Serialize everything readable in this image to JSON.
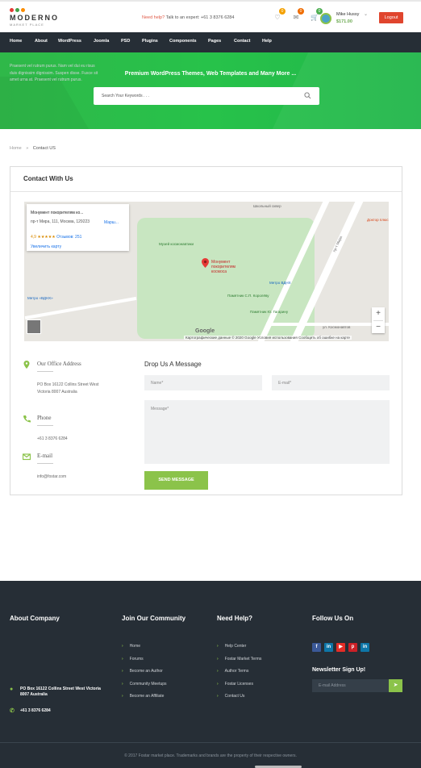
{
  "header": {
    "logo": {
      "brand": "MODERNO",
      "sub": "MARKET PLACE",
      "dot_colors": [
        "#e53935",
        "#43a047",
        "#fb8c00"
      ]
    },
    "help_prefix": "Need help?",
    "help_text": " Talk to an expert: +61 3 8376 6284",
    "icons": [
      {
        "icon": "heart-icon",
        "badge": "0",
        "badge_color": "#f4a100"
      },
      {
        "icon": "mail-icon",
        "badge": "0",
        "badge_color": "#ef6c00"
      },
      {
        "icon": "cart-icon",
        "badge": "0",
        "badge_color": "#4caf50"
      }
    ],
    "user_name": "Mike Hussy",
    "user_balance": "$171.00",
    "logout_label": "Logout"
  },
  "nav": {
    "items": [
      "Home",
      "About",
      "WordPress",
      "Joomla",
      "PSD",
      "Plugins",
      "Components",
      "Pages",
      "Contact",
      "Help"
    ]
  },
  "hero": {
    "title": "Premium WordPress Themes, Web Templates and Many More ...",
    "search_placeholder": "Search Your Keywords . . ."
  },
  "breadcrumb": {
    "home": "Home",
    "sep": "»",
    "current": "Contact US"
  },
  "card": {
    "title": "Contact With Us",
    "map": {
      "place_name": "Монумент покорителям ко...",
      "place_address": "пр-т Мира, 111, Москва, 129223",
      "rating": "4,9 ★★★★★",
      "reviews": "Отзывов: 251",
      "enlarge": "Увеличить карту",
      "route": "Марш...",
      "pin_label": "Монумент покорителям космоса",
      "google": "Google",
      "attribution": "Картографические данные © 2020 Google   Условия использования   Сообщить об ошибке на карте",
      "labels": {
        "museum": "Музей космонавтики",
        "metro_vdnh": "Метро ВДНХ",
        "metro_vdnh_short": "Метро «ВДНХ»",
        "school": "Школьный сквер",
        "korolev": "Памятник С.П. Королёву",
        "gagarin": "Памятник Ю. Гагарину",
        "kosmonavtov": "ул. Космонавтов",
        "doctor": "Доктор плюс",
        "mira": "пр-т Мира"
      }
    },
    "office": {
      "label": "Our Office Address",
      "value": "PO Box 16122 Collins Street West Victoria 8007 Australia"
    },
    "phone": {
      "label": "Phone",
      "value": "+61 3 8376 6284"
    },
    "email": {
      "label": "E-mail",
      "value": "info@fostar.com"
    },
    "form": {
      "title": "Drop Us A Message",
      "name_placeholder": "Name*",
      "email_placeholder": "E-mail*",
      "message_placeholder": "Message*",
      "send_label": "SEND MESSAGE"
    }
  },
  "footer": {
    "about": {
      "title": "About Company",
      "text": "Praesent vel rutrum purus. Nam vel dui eu risus duis dignissim dignissim. Suspen disse. Fusce sit amet urna at. Praesent vel rutrum purus.",
      "address": "PO Box 16122 Collins Street West Victoria 8007 Australia",
      "phone": "+61 3 8376 6284"
    },
    "community": {
      "title": "Join Our Community",
      "links": [
        "Home",
        "Forums",
        "Become an Author",
        "Community Meetups",
        "Become an Affiliate"
      ]
    },
    "help": {
      "title": "Need Help?",
      "links": [
        "Help Center",
        "Fostar Market Terms",
        "Author Terms",
        "Fostar Licenses",
        "Contact Us"
      ]
    },
    "follow": {
      "title": "Follow Us On",
      "social": [
        {
          "icon": "facebook-icon",
          "glyph": "f",
          "color": "#3b5998"
        },
        {
          "icon": "linkedin-icon",
          "glyph": "in",
          "color": "#0e76a8"
        },
        {
          "icon": "youtube-icon",
          "glyph": "▶",
          "color": "#e52d27"
        },
        {
          "icon": "pinterest-icon",
          "glyph": "p",
          "color": "#cb2027"
        },
        {
          "icon": "linkedin-icon",
          "glyph": "in",
          "color": "#0e76a8"
        }
      ],
      "newsletter_title": "Newsletter Sign Up!",
      "email_placeholder": "E-mail Address"
    },
    "copyright": "© 2017 Fostar market place. Trademarks and brands are the property of their respective owners."
  },
  "colors": {
    "accent": "#8bc34a",
    "nav_bg": "#262e36",
    "logout": "#e0452e",
    "hero": "#27c24a"
  }
}
